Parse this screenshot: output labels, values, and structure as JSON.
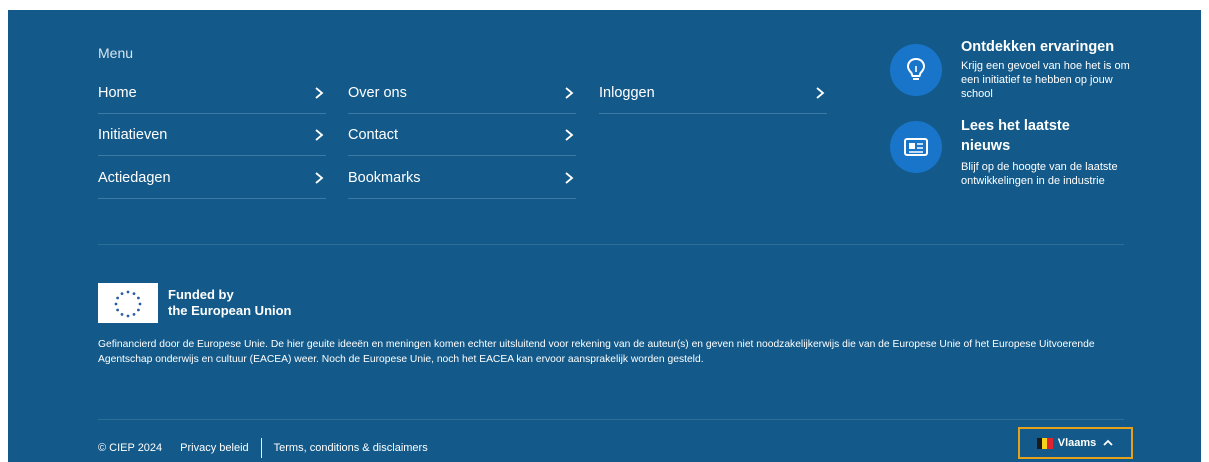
{
  "menu": {
    "title": "Menu",
    "items": [
      {
        "label": "Home"
      },
      {
        "label": "Initiatieven"
      },
      {
        "label": "Actiedagen"
      },
      {
        "label": "Over ons"
      },
      {
        "label": "Contact"
      },
      {
        "label": "Bookmarks"
      },
      {
        "label": "Inloggen"
      }
    ]
  },
  "promos": [
    {
      "title": "Ontdekken ervaringen",
      "text": "Krijg een gevoel van hoe het is om een initiatief te hebben op jouw school",
      "icon": "lightbulb-icon"
    },
    {
      "title": "Lees het laatste nieuws",
      "text": "Blijf op de hoogte van de laatste ontwikkelingen in de industrie",
      "icon": "newspaper-icon"
    }
  ],
  "eu": {
    "line1": "Funded by",
    "line2": "the European Union",
    "disclaimer": "Gefinancierd door de Europese Unie. De hier geuite ideeën en meningen komen echter uitsluitend voor rekening van de auteur(s) en geven niet noodzakelijkerwijs die van de Europese Unie of het Europese Uitvoerende Agentschap onderwijs en cultuur (EACEA) weer. Noch de Europese Unie, noch het EACEA kan ervoor aansprakelijk worden gesteld."
  },
  "bottom": {
    "copyright": "© CIEP 2024",
    "privacy": "Privacy beleid",
    "terms": "Terms, conditions & disclaimers",
    "language": "Vlaams"
  },
  "colors": {
    "background": "#135a8a",
    "icon_circle": "#1875c9",
    "language_outline": "#e3a21a",
    "flag": [
      "#1a1a1a",
      "#f5d31b",
      "#e0242f"
    ]
  }
}
